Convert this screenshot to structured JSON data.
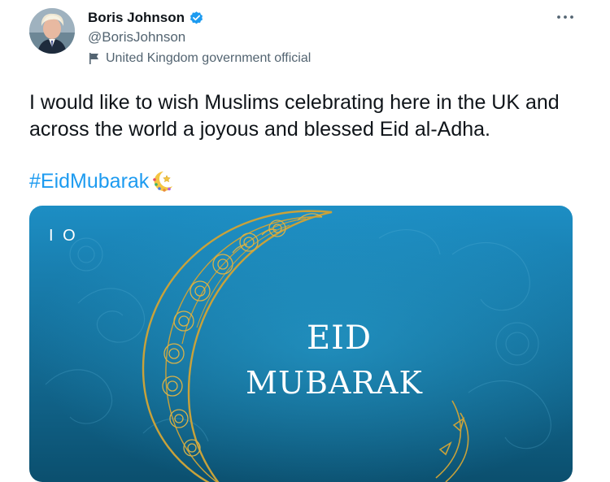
{
  "author": {
    "display_name": "Boris Johnson",
    "handle": "@BorisJohnson",
    "verified": true,
    "affiliation_label": "United Kingdom government official",
    "avatar_icon": "profile-photo",
    "verified_icon": "verified-badge-icon",
    "affiliation_icon": "flag-icon"
  },
  "menu": {
    "more_icon": "ellipsis-icon"
  },
  "tweet": {
    "text": "I would like to wish Muslims celebrating here in the UK and across the world a joyous and blessed Eid al-Adha.",
    "hashtag": "#EidMubarak",
    "hashflag_icon": "crescent-moon-star-icon"
  },
  "media": {
    "logo_text": "I O",
    "greeting_line1": "EID",
    "greeting_line2": "MUBARAK",
    "background_color_top": "#1d8ec4",
    "background_color_bottom": "#0b4f6e",
    "moon_color": "#c9a23a"
  },
  "colors": {
    "link": "#1d9bf0",
    "secondary_text": "#536471",
    "primary_text": "#0f1419"
  }
}
